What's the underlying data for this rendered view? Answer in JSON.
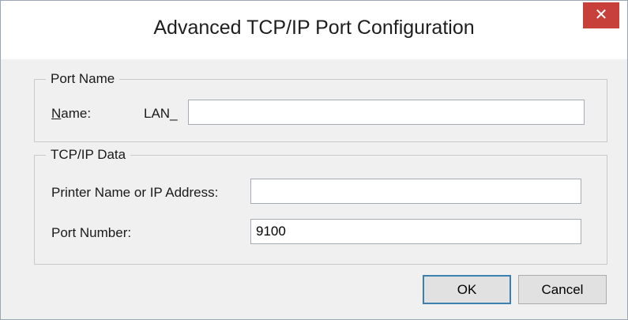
{
  "window": {
    "title": "Advanced TCP/IP Port Configuration",
    "close_glyph": "✕"
  },
  "port_name_group": {
    "legend": "Port Name",
    "name_label_prefix": "N",
    "name_label_rest": "ame:",
    "name_prefix": "LAN_",
    "name_value": ""
  },
  "tcpip_group": {
    "legend": "TCP/IP Data",
    "address_label": "Printer Name or IP Address:",
    "address_value": "",
    "port_label": "Port Number:",
    "port_value": "9100"
  },
  "buttons": {
    "ok": "OK",
    "cancel": "Cancel"
  }
}
